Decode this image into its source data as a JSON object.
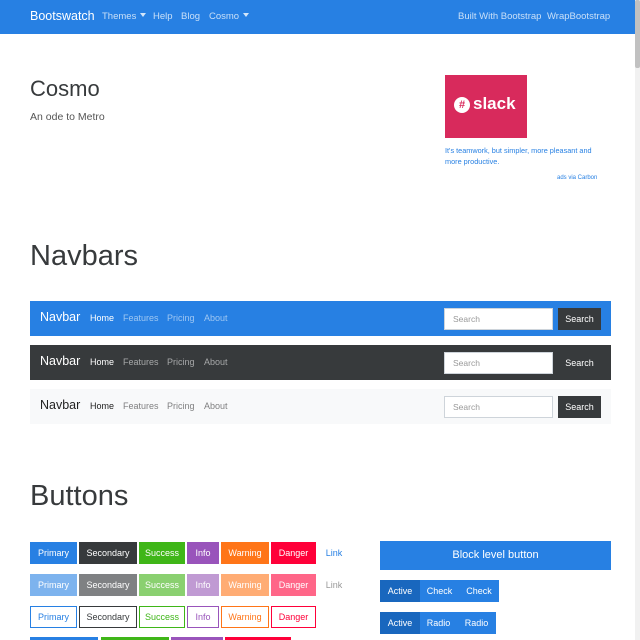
{
  "topnav": {
    "brand": "Bootswatch",
    "themes": "Themes",
    "help": "Help",
    "blog": "Blog",
    "theme_current": "Cosmo",
    "built": "Built With Bootstrap",
    "wrap": "WrapBootstrap"
  },
  "hero": {
    "title": "Cosmo",
    "subtitle": "An ode to Metro"
  },
  "ad": {
    "logo_text": "slack",
    "text": "It's teamwork, but simpler, more pleasant and more productive.",
    "via": "ads via Carbon"
  },
  "navbars": {
    "title": "Navbars",
    "brand": "Navbar",
    "links": [
      "Home",
      "Features",
      "Pricing",
      "About"
    ],
    "search_placeholder": "Search",
    "search_button": "Search"
  },
  "buttons": {
    "title": "Buttons",
    "labels": [
      "Primary",
      "Secondary",
      "Success",
      "Info",
      "Warning",
      "Danger",
      "Link"
    ],
    "block": "Block level button",
    "check_group": [
      "Active",
      "Check",
      "Check"
    ],
    "radio_group": [
      "Active",
      "Radio",
      "Radio"
    ]
  },
  "colors": {
    "primary": "#2780e3",
    "secondary": "#373a3c",
    "success": "#3fb618",
    "info": "#9954bb",
    "warning": "#ff7518",
    "danger": "#ff0039",
    "light": "#f8f9fa"
  }
}
